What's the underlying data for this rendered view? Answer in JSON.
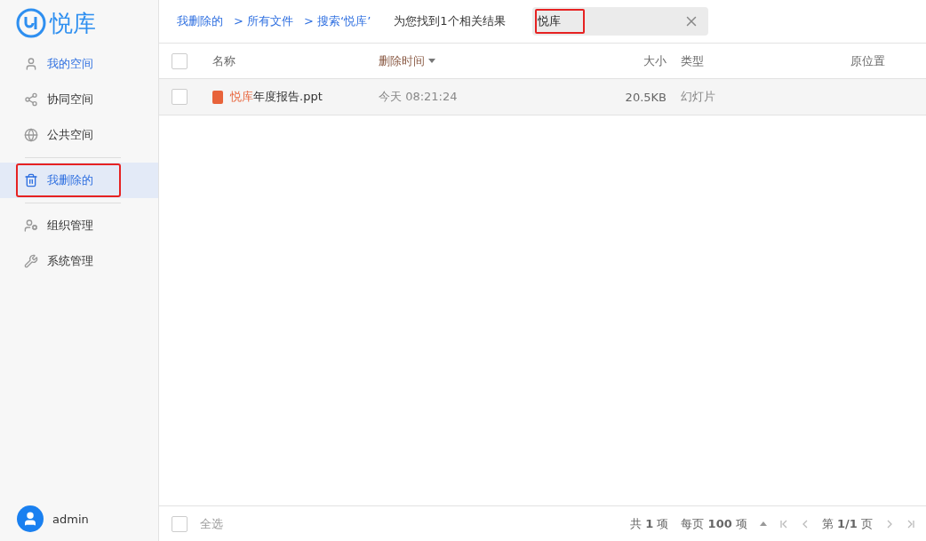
{
  "logo": {
    "text": "悦库"
  },
  "sidebar": {
    "items": [
      {
        "label": "我的空间",
        "selected": false,
        "tinted": true,
        "highlighted": false,
        "divider_after": false
      },
      {
        "label": "协同空间",
        "selected": false,
        "tinted": false,
        "highlighted": false,
        "divider_after": false
      },
      {
        "label": "公共空间",
        "selected": false,
        "tinted": false,
        "highlighted": false,
        "divider_after": true
      },
      {
        "label": "我删除的",
        "selected": true,
        "tinted": true,
        "highlighted": true,
        "divider_after": true
      },
      {
        "label": "组织管理",
        "selected": false,
        "tinted": false,
        "highlighted": false,
        "divider_after": false
      },
      {
        "label": "系统管理",
        "selected": false,
        "tinted": false,
        "highlighted": false,
        "divider_after": false
      }
    ],
    "user": {
      "name": "admin"
    }
  },
  "breadcrumbs": [
    {
      "label": "我删除的"
    },
    {
      "label": "> 所有文件"
    },
    {
      "label": "> 搜索‘悦库’"
    }
  ],
  "result_text": "为您找到1个相关结果",
  "search": {
    "value": "悦库",
    "highlighted": true
  },
  "table": {
    "header_checked": false,
    "columns": [
      {
        "label": "名称",
        "sorted": false
      },
      {
        "label": "删除时间",
        "sorted": true
      },
      {
        "label": "大小",
        "sorted": false
      },
      {
        "label": "类型",
        "sorted": false
      },
      {
        "label": "原位置",
        "sorted": false
      }
    ],
    "rows": [
      {
        "checked": false,
        "name_match": "悦库",
        "name_rest": "年度报告.ppt",
        "time": "今天 08:21:24",
        "size": "20.5KB",
        "type": "幻灯片"
      }
    ]
  },
  "footer": {
    "select_all": {
      "label": "全选",
      "checked": false
    },
    "total": "共 **1** 项",
    "per_page": "每页 **100** 项",
    "page": "第 **1/1** 页"
  }
}
